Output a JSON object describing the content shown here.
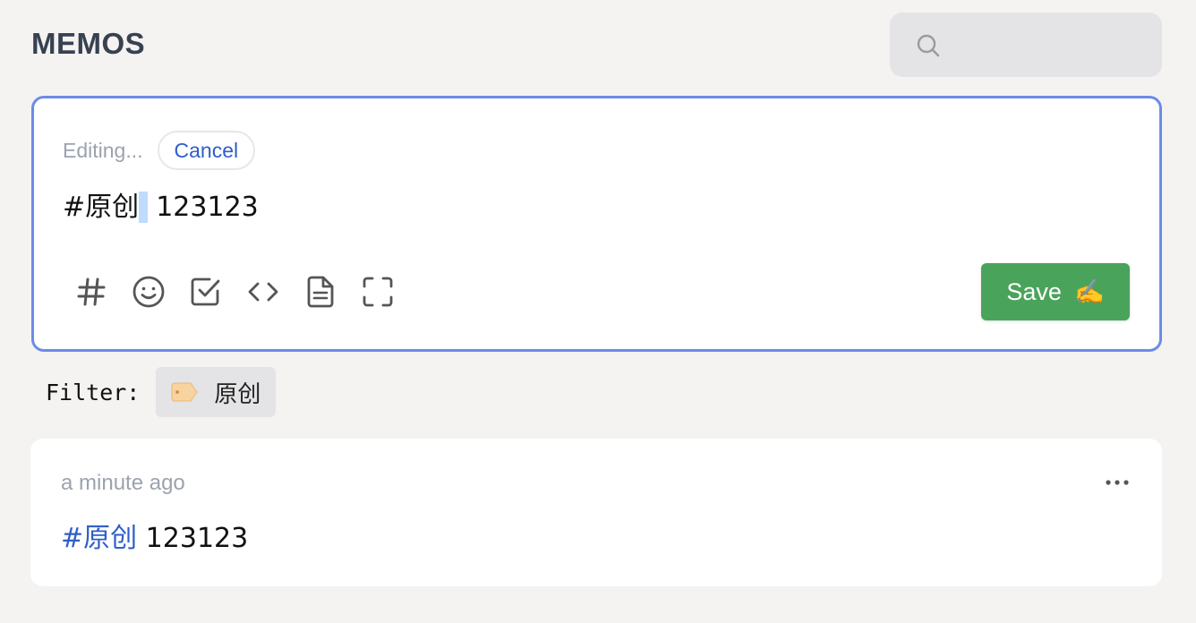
{
  "app": {
    "title": "MEMOS"
  },
  "search": {
    "placeholder": "",
    "value": ""
  },
  "editor": {
    "status": "Editing...",
    "cancel_label": "Cancel",
    "content_before": "#原创",
    "content_selected": " ",
    "content_after": " 123123",
    "toolbar": [
      {
        "name": "tag-icon",
        "label": "#"
      },
      {
        "name": "emoji-icon"
      },
      {
        "name": "checkbox-icon"
      },
      {
        "name": "code-icon"
      },
      {
        "name": "file-icon"
      },
      {
        "name": "fullscreen-icon"
      }
    ],
    "save_label": "Save",
    "save_emoji": "✍️"
  },
  "filter": {
    "label": "Filter:",
    "chip_label": "原创",
    "chip_icon": "tag-label-icon"
  },
  "memos": [
    {
      "time": "a minute ago",
      "tag": "#原创",
      "text": " 123123"
    }
  ],
  "colors": {
    "accent": "#6c8be6",
    "link": "#2f5ec7",
    "save": "#4aa35a",
    "background": "#f4f3f2"
  }
}
